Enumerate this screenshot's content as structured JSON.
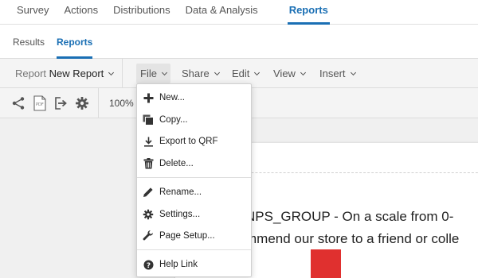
{
  "topnav": {
    "tabs": [
      {
        "label": "Survey"
      },
      {
        "label": "Actions"
      },
      {
        "label": "Distributions"
      },
      {
        "label": "Data & Analysis"
      },
      {
        "label": "Reports"
      }
    ],
    "active": "Reports"
  },
  "subnav": {
    "tabs": [
      {
        "label": "Results"
      },
      {
        "label": "Reports"
      }
    ],
    "active": "Reports"
  },
  "toolbar": {
    "report_label": "Report",
    "report_name": "New Report",
    "menus": [
      {
        "label": "File"
      },
      {
        "label": "Share"
      },
      {
        "label": "Edit"
      },
      {
        "label": "View"
      },
      {
        "label": "Insert"
      }
    ],
    "active_menu": "File"
  },
  "iconbar": {
    "icons": [
      "share-icon",
      "pdf-icon",
      "export-icon",
      "gear-icon"
    ],
    "pdf_text": "PDF",
    "zoom": "100%"
  },
  "file_menu": {
    "groups": [
      [
        {
          "label": "New...",
          "icon": "plus-icon"
        },
        {
          "label": "Copy...",
          "icon": "copy-icon"
        },
        {
          "label": "Export to QRF",
          "icon": "download-icon"
        },
        {
          "label": "Delete...",
          "icon": "trash-icon"
        }
      ],
      [
        {
          "label": "Rename...",
          "icon": "pencil-icon"
        },
        {
          "label": "Settings...",
          "icon": "gear-icon"
        },
        {
          "label": "Page Setup...",
          "icon": "wrench-icon"
        }
      ],
      [
        {
          "label": "Help Link",
          "icon": "help-icon"
        }
      ]
    ]
  },
  "canvas": {
    "chart_title_line1": "NPS_GROUP - On a scale from 0-",
    "chart_title_line2": "mmend our store to a friend or colle",
    "bar_color": "#e0302f"
  },
  "colors": {
    "accent": "#1a6fb4",
    "bar": "#e0302f"
  }
}
